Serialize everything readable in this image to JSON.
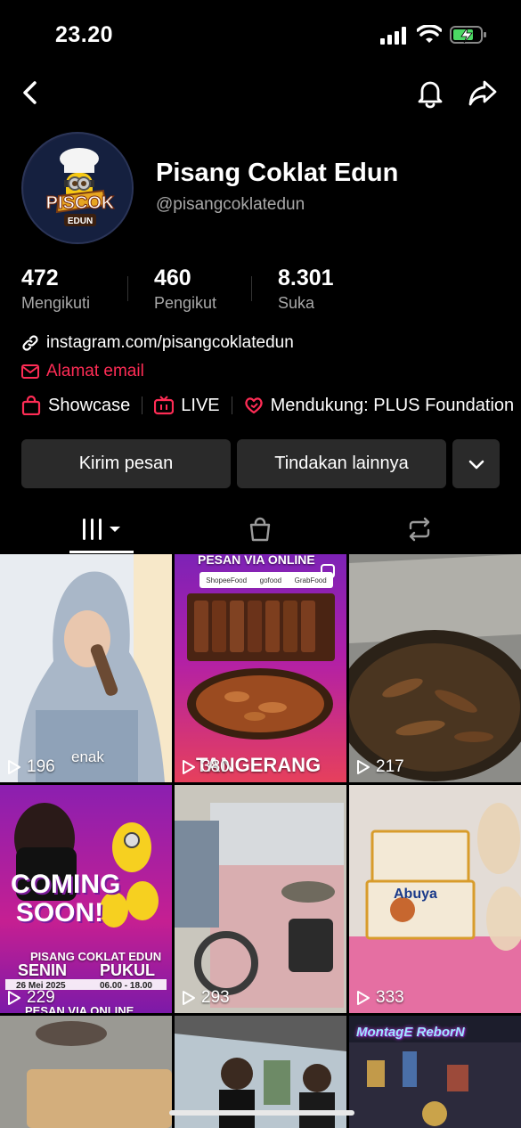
{
  "status": {
    "time": "23.20"
  },
  "profile": {
    "display_name": "Pisang Coklat Edun",
    "username": "@pisangcoklatedun",
    "avatar_text": "PISCOK",
    "avatar_subtext": "EDUN"
  },
  "stats": [
    {
      "value": "472",
      "label": "Mengikuti"
    },
    {
      "value": "460",
      "label": "Pengikut"
    },
    {
      "value": "8.301",
      "label": "Suka"
    }
  ],
  "links": {
    "instagram": "instagram.com/pisangcoklatedun",
    "email": "Alamat email"
  },
  "features": {
    "showcase": "Showcase",
    "live": "LIVE",
    "supports": "Mendukung: PLUS Foundation"
  },
  "actions": {
    "message": "Kirim pesan",
    "more": "Tindakan lainnya"
  },
  "videos": [
    {
      "views": "196",
      "caption": "enak"
    },
    {
      "views": "380",
      "caption_top": "PESAN VIA ONLINE",
      "caption_bottom": "TANGERANG",
      "apps": [
        "ShopeeFood",
        "gofood",
        "GrabFood"
      ]
    },
    {
      "views": "217"
    },
    {
      "views": "229",
      "caption_main": "COMING SOON!",
      "line1": "PISANG COKLAT EDUN",
      "day": "SENIN",
      "time_label": "PUKUL",
      "date": "26 Mei 2025",
      "hours": "06.00 - 18.00",
      "bottom": "PESAN VIA ONLINE"
    },
    {
      "views": "293"
    },
    {
      "views": "333",
      "brand": "Abuya"
    },
    {
      "views": ""
    },
    {
      "views": ""
    },
    {
      "views": "",
      "title": "MontagE ReborN"
    }
  ],
  "colors": {
    "accent": "#fe2c55",
    "button_bg": "#2a2a2a",
    "muted_text": "#a8a8a8"
  }
}
